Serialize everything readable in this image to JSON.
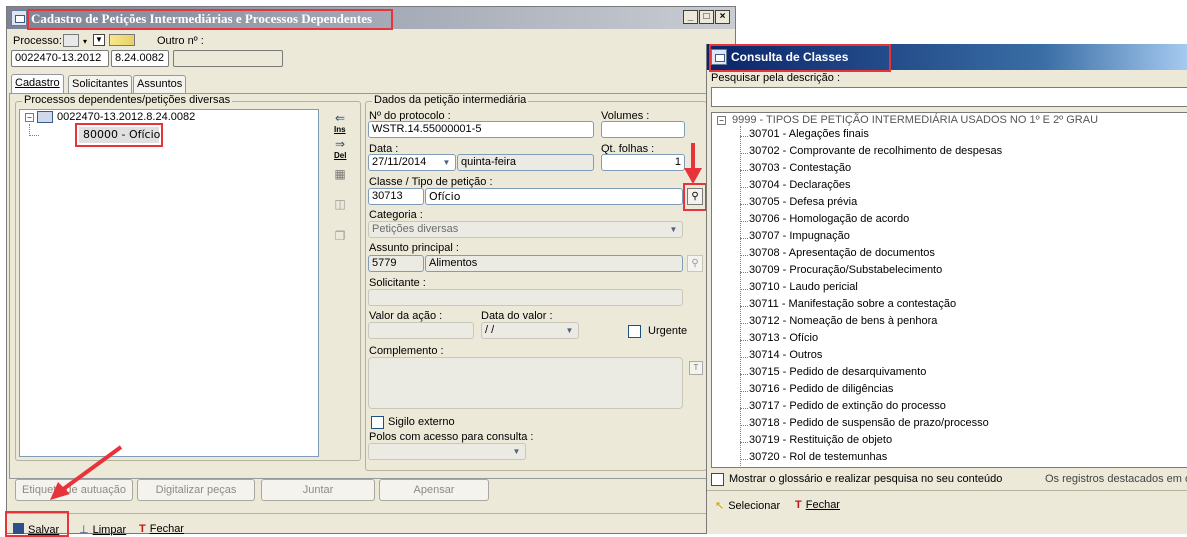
{
  "main_window": {
    "title": "Cadastro de Petições Intermediárias e Processos Dependentes",
    "controls": {
      "minimize": "_",
      "maximize": "□",
      "close": "×"
    },
    "processo_label": "Processo:",
    "outro_label": "Outro nº :",
    "processo_value": "0022470-13.2012",
    "processo_value2": "8.24.0082",
    "outro_value": "",
    "tabs": [
      {
        "label": "Cadastro"
      },
      {
        "label": "Solicitantes"
      },
      {
        "label": "Assuntos"
      }
    ],
    "left_group_title": "Processos dependentes/petições diversas",
    "tree_root": "0022470-13.2012.8.24.0082",
    "tree_child": "80000 - Ofício",
    "side_ins": "Ins",
    "side_del": "Del",
    "right_group_title": "Dados da petição intermediária",
    "fields": {
      "protocolo_label": "Nº do protocolo :",
      "protocolo_value": "WSTR.14.55000001-5",
      "volumes_label": "Volumes :",
      "volumes_value": "",
      "data_label": "Data :",
      "data_value": "27/11/2014",
      "weekday_value": "quinta-feira",
      "folhas_label": "Qt. folhas :",
      "folhas_value": "1",
      "classe_label": "Classe / Tipo de petição :",
      "classe_code": "30713",
      "classe_name": "Ofício",
      "categoria_label": "Categoria :",
      "categoria_value": "Petições diversas",
      "assunto_label": "Assunto principal :",
      "assunto_code": "5779",
      "assunto_name": "Alimentos",
      "solicitante_label": "Solicitante :",
      "valor_acao_label": "Valor da ação :",
      "data_valor_label": "Data do valor :",
      "data_valor_value": "/ /",
      "urgente_label": "Urgente",
      "complemento_label": "Complemento :",
      "sigilo_label": "Sigilo externo",
      "polos_label": "Polos com acesso para consulta :"
    },
    "buttons": {
      "etiqueta": "Etiqueta de autuação",
      "digitalizar": "Digitalizar peças",
      "juntar": "Juntar",
      "apensar": "Apensar"
    },
    "toolbar": {
      "salvar": "Salvar",
      "limpar": "Limpar",
      "fechar": "Fechar"
    }
  },
  "consulta_window": {
    "title": "Consulta de Classes",
    "search_label": "Pesquisar pela descrição :",
    "search_value": "",
    "root": "9999 - TIPOS DE PETIÇÃO INTERMEDIÁRIA USADOS NO 1º E 2º GRAU",
    "items": [
      "30701 - Alegações finais",
      "30702 - Comprovante de recolhimento de despesas",
      "30703 - Contestação",
      "30704 - Declarações",
      "30705 - Defesa prévia",
      "30706 - Homologação de acordo",
      "30707 - Impugnação",
      "30708 - Apresentação de documentos",
      "30709 - Procuração/Substabelecimento",
      "30710 - Laudo pericial",
      "30711 - Manifestação sobre a contestação",
      "30712 - Nomeação de bens à penhora",
      "30713 - Ofício",
      "30714 - Outros",
      "30715 - Pedido de desarquivamento",
      "30716 - Pedido de diligências",
      "30717 - Pedido de extinção do processo",
      "30718 - Pedido de suspensão de prazo/processo",
      "30719 - Restituição de objeto",
      "30720 - Rol de testemunhas"
    ],
    "glossario_label": "Mostrar o glossário e realizar pesquisa no seu conteúdo",
    "registros_text": "Os registros destacados em cir",
    "selecionar": "Selecionar",
    "fechar": "Fechar"
  }
}
